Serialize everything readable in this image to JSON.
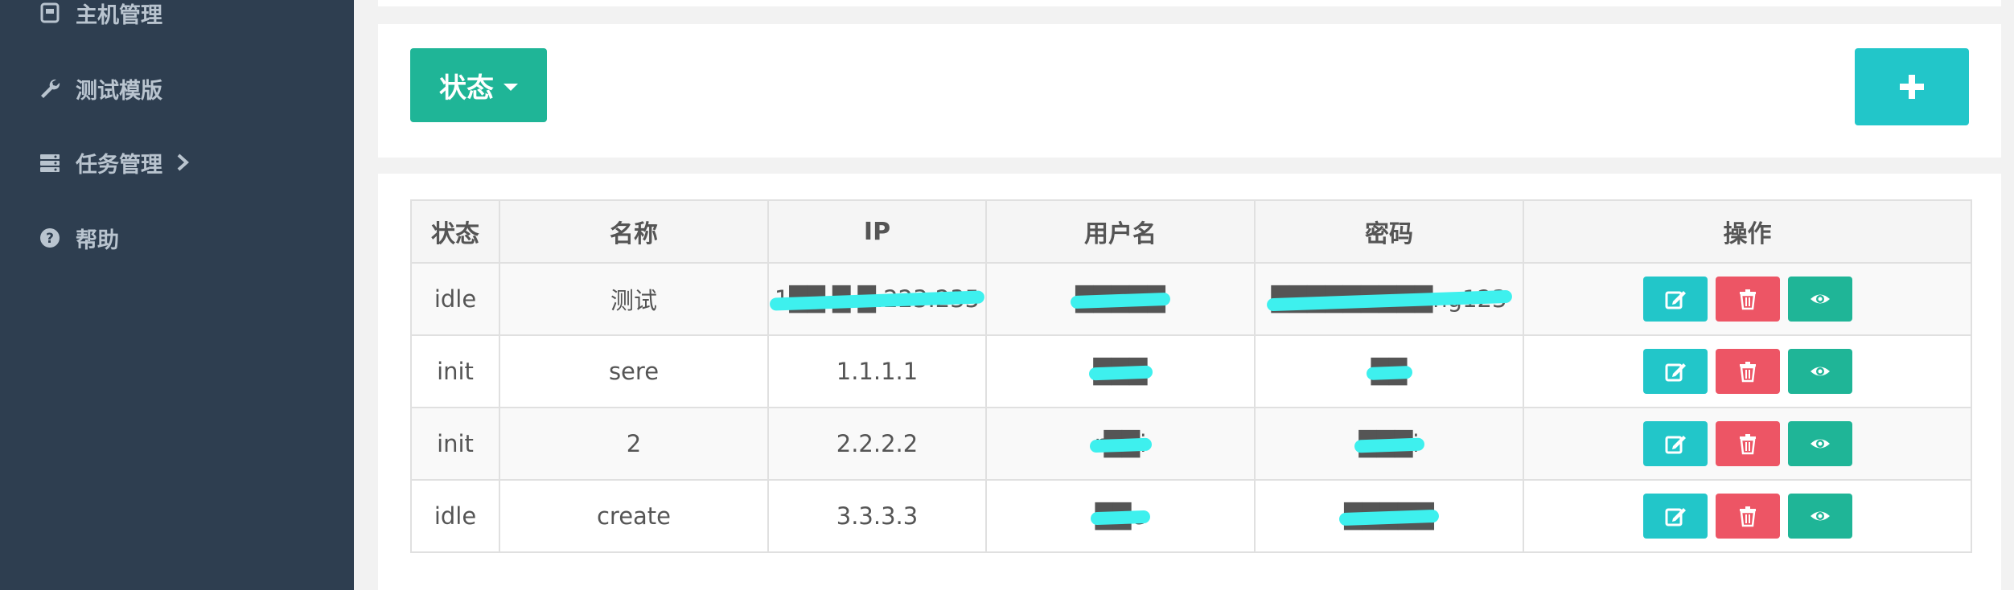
{
  "sidebar": {
    "items": [
      {
        "label": "主机管理",
        "icon": "host-icon"
      },
      {
        "label": "测试模版",
        "icon": "wrench-icon"
      },
      {
        "label": "任务管理",
        "icon": "server-icon"
      },
      {
        "label": "帮助",
        "icon": "question-icon"
      }
    ]
  },
  "toolbar": {
    "status_label": "状态",
    "add_label": "+"
  },
  "table": {
    "headers": [
      "状态",
      "名称",
      "IP",
      "用户名",
      "密码",
      "操作"
    ],
    "rows": [
      {
        "status": "idle",
        "name": "测试",
        "ip": "1██.█.█.223.235",
        "username": "█████",
        "password": "█████████ng123"
      },
      {
        "status": "init",
        "name": "sere",
        "ip": "1.1.1.1",
        "username": "███",
        "password": "██"
      },
      {
        "status": "init",
        "name": "2",
        "ip": "2.2.2.2",
        "username": "r██i",
        "password": "███i"
      },
      {
        "status": "idle",
        "name": "create",
        "ip": "3.3.3.3",
        "username": "██e",
        "password": "█████"
      }
    ]
  },
  "colors": {
    "sidebar_bg": "#2e3e50",
    "primary_green": "#1fb597",
    "accent_cyan": "#22c6c9",
    "danger_red": "#ed5565"
  }
}
